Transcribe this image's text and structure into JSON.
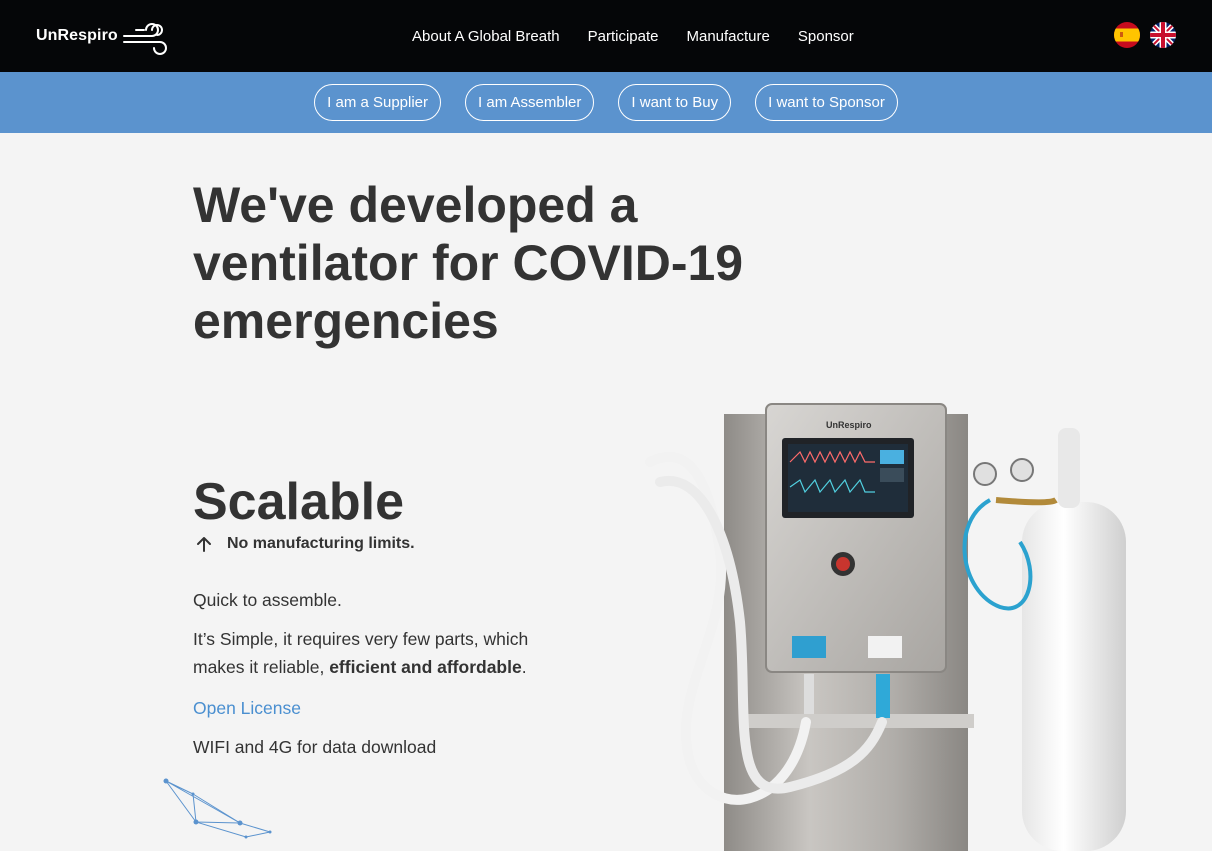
{
  "header": {
    "logo_text": "UnRespiro",
    "nav": [
      {
        "label": "About A Global Breath"
      },
      {
        "label": "Participate"
      },
      {
        "label": "Manufacture"
      },
      {
        "label": "Sponsor"
      }
    ],
    "languages": [
      {
        "icon": "spain-flag-icon"
      },
      {
        "icon": "uk-flag-icon"
      }
    ]
  },
  "subnav": {
    "buttons": [
      {
        "label": "I am a Supplier"
      },
      {
        "label": "I am Assembler"
      },
      {
        "label": "I want to Buy"
      },
      {
        "label": "I want to Sponsor"
      }
    ]
  },
  "hero": {
    "title": "We've developed a ventilator for COVID-19 emergencies"
  },
  "feature": {
    "title": "Scalable",
    "subtitle": "No manufacturing limits.",
    "line1": "Quick to assemble.",
    "line2_a": "It’s Simple, it requires very few parts, which makes it reliable,",
    "line2_b": "efficient and affordable",
    "line2_c": ".",
    "license_link": "Open License",
    "line4": "WIFI and 4G for data download"
  },
  "colors": {
    "topbar": "#050608",
    "subbar": "#5b93ce",
    "background": "#f4f4f4",
    "link": "#4a8fd0"
  }
}
